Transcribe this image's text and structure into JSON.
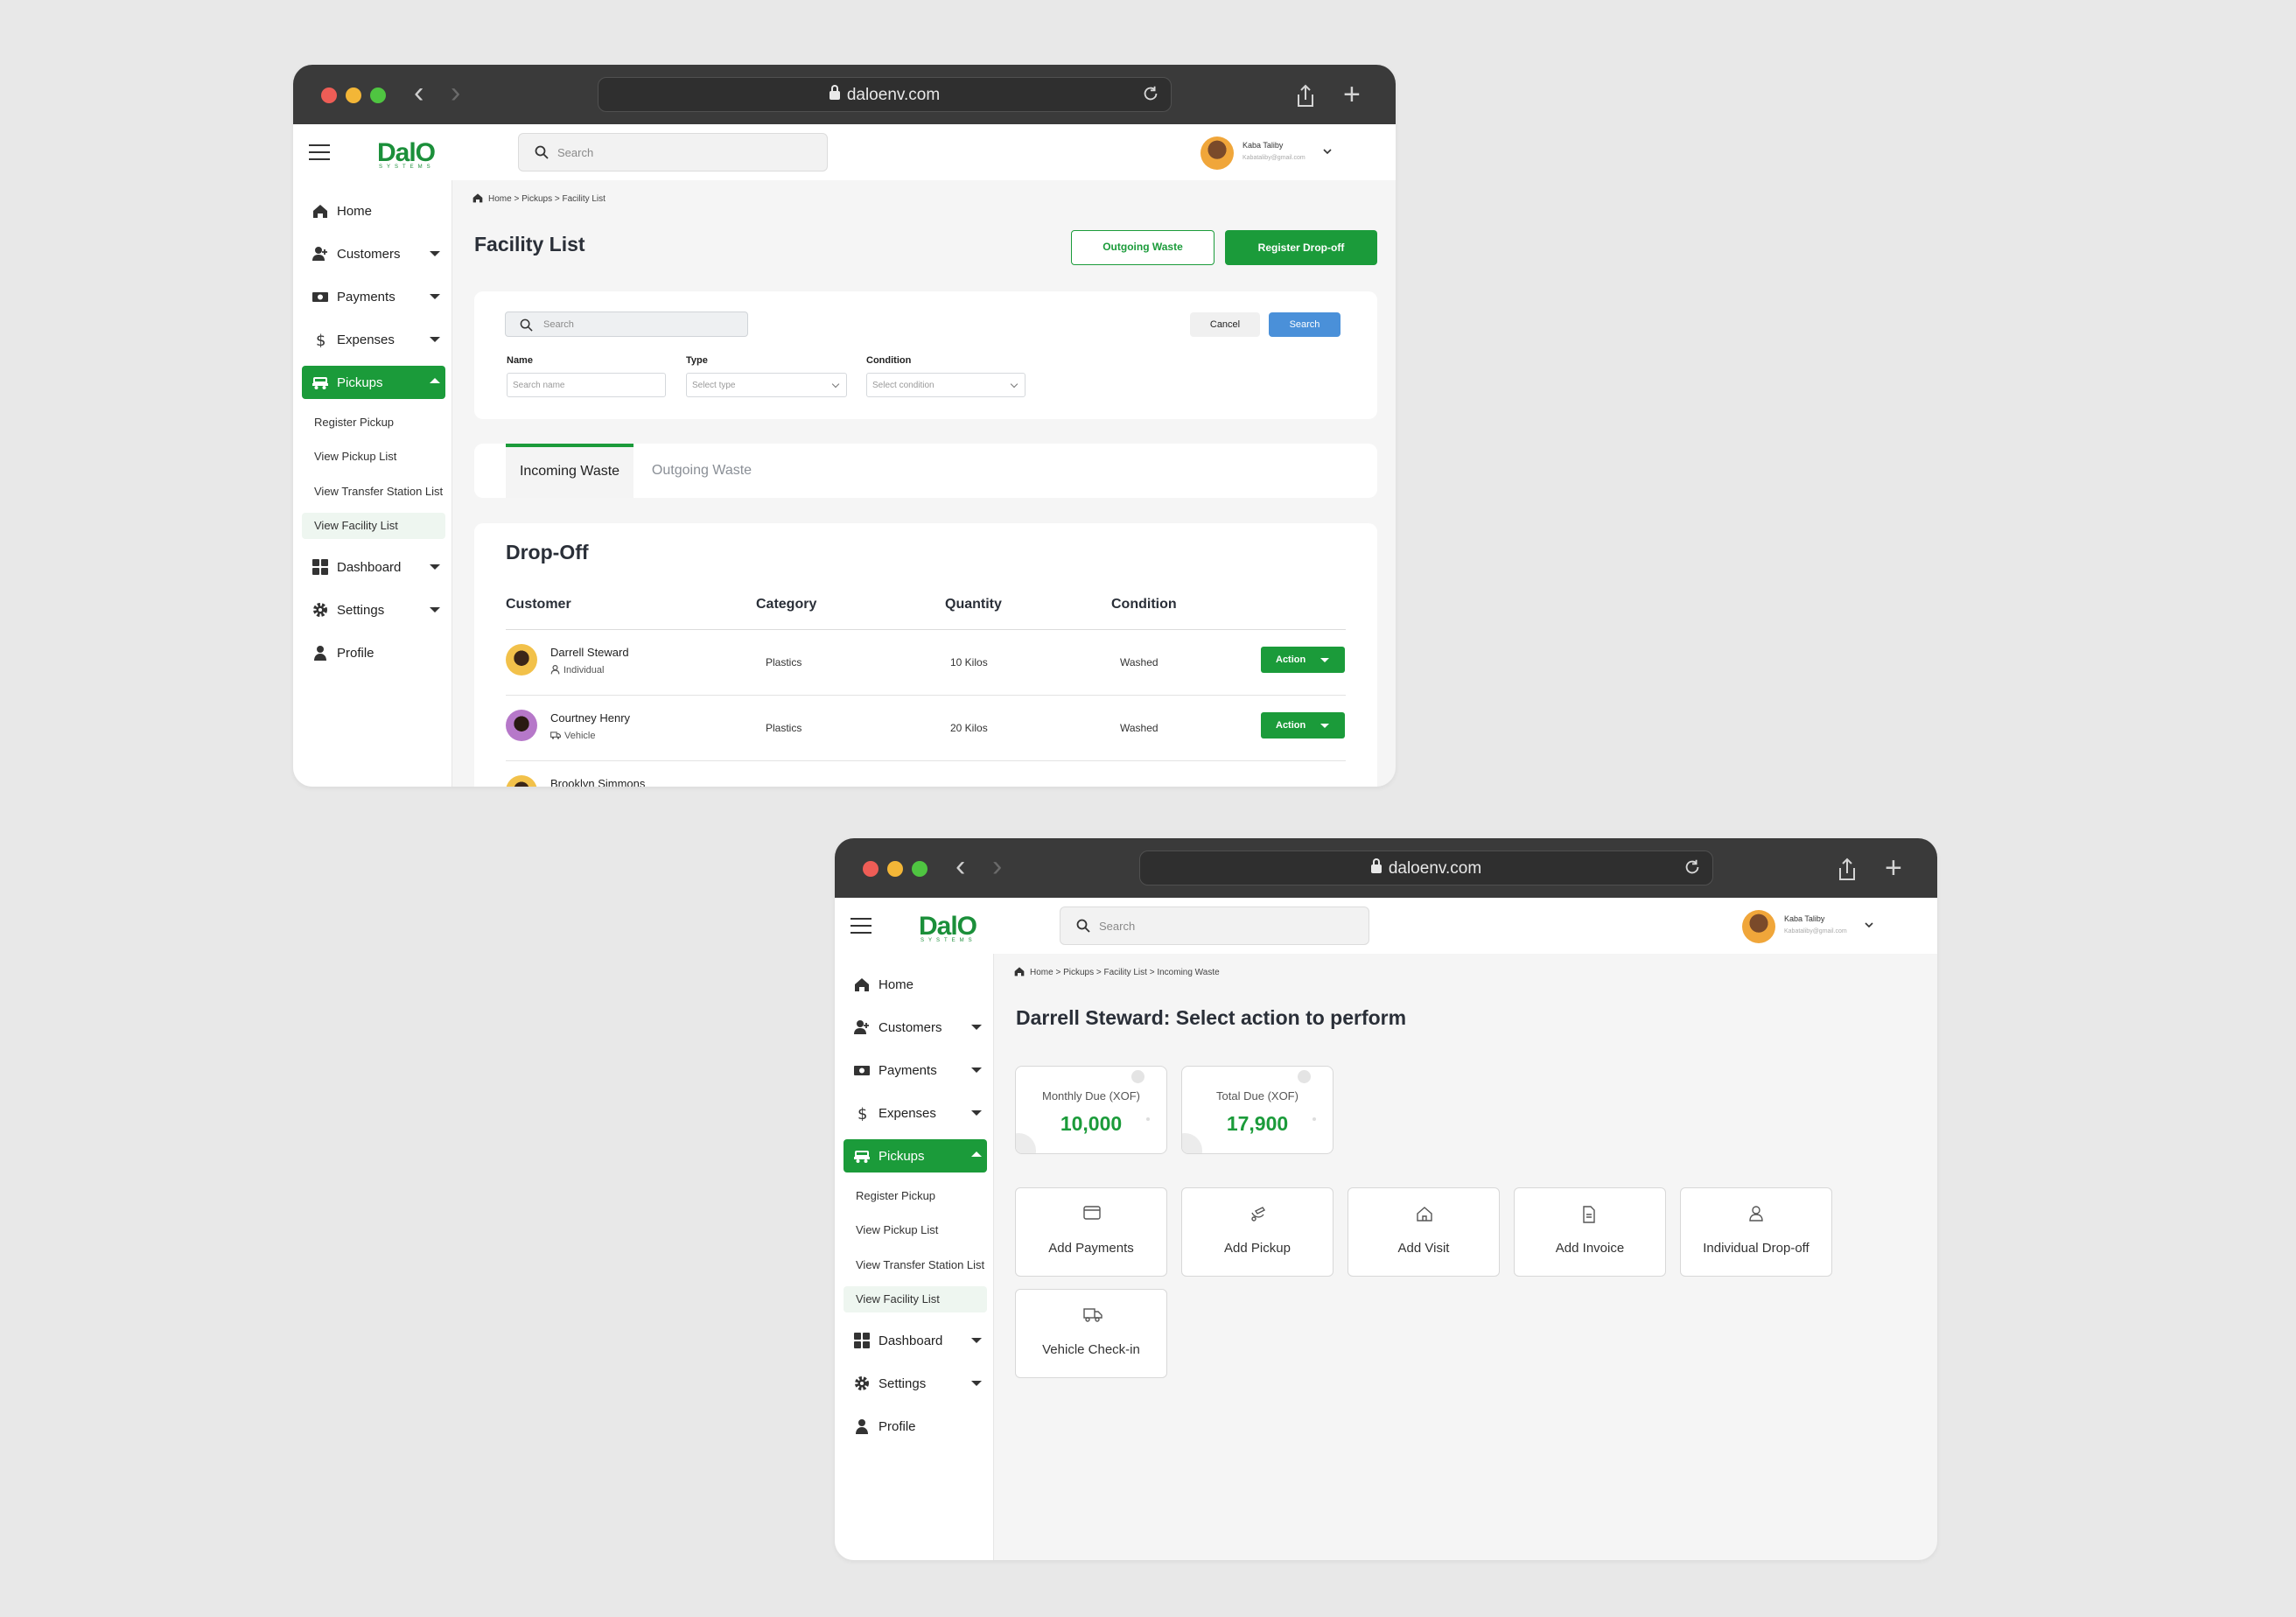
{
  "browser": {
    "url": "daloenv.com"
  },
  "header": {
    "logo": "DalO",
    "logo_sub": "SYSTEMS",
    "search_placeholder": "Search",
    "user_name": "Kaba Taliby",
    "user_email": "Kabataliby@gmail.com"
  },
  "sidebar": {
    "items": [
      {
        "label": "Home",
        "icon": "home-icon"
      },
      {
        "label": "Customers",
        "icon": "user-add-icon"
      },
      {
        "label": "Payments",
        "icon": "cash-icon"
      },
      {
        "label": "Expenses",
        "icon": "dollar-icon"
      },
      {
        "label": "Pickups",
        "icon": "truck-icon"
      },
      {
        "label": "Dashboard",
        "icon": "grid-icon"
      },
      {
        "label": "Settings",
        "icon": "gear-icon"
      },
      {
        "label": "Profile",
        "icon": "person-icon"
      }
    ],
    "subitems": [
      "Register Pickup",
      "View Pickup List",
      "View Transfer Station List",
      "View Facility List"
    ]
  },
  "facility": {
    "breadcrumb": "Home > Pickups > Facility List",
    "title": "Facility List",
    "outgoing_btn": "Outgoing Waste",
    "register_btn": "Register Drop-off",
    "filters": {
      "search_placeholder": "Search",
      "cancel": "Cancel",
      "search": "Search",
      "name_label": "Name",
      "name_placeholder": "Search name",
      "type_label": "Type",
      "type_placeholder": "Select type",
      "condition_label": "Condition",
      "condition_placeholder": "Select condition"
    },
    "tabs": [
      "Incoming Waste",
      "Outgoing Waste"
    ],
    "section_title": "Drop-Off",
    "columns": [
      "Customer",
      "Category",
      "Quantity",
      "Condition"
    ],
    "rows": [
      {
        "name": "Darrell Steward",
        "type": "Individual",
        "category": "Plastics",
        "quantity": "10 Kilos",
        "condition": "Washed",
        "action": "Action"
      },
      {
        "name": "Courtney Henry",
        "type": "Vehicle",
        "category": "Plastics",
        "quantity": "20 Kilos",
        "condition": "Washed",
        "action": "Action"
      },
      {
        "name": "Brooklyn Simmons"
      }
    ]
  },
  "action_page": {
    "breadcrumb": "Home > Pickups > Facility List > Incoming Waste",
    "title": "Darrell Steward: Select action to perform",
    "dues": [
      {
        "label": "Monthly Due (XOF)",
        "value": "10,000"
      },
      {
        "label": "Total Due (XOF)",
        "value": "17,900"
      }
    ],
    "actions": [
      {
        "label": "Add Payments",
        "icon": "card-icon"
      },
      {
        "label": "Add Pickup",
        "icon": "pickup-icon"
      },
      {
        "label": "Add Visit",
        "icon": "house-icon"
      },
      {
        "label": "Add Invoice",
        "icon": "document-icon"
      },
      {
        "label": "Individual Drop-off",
        "icon": "person-icon"
      },
      {
        "label": "Vehicle Check-in",
        "icon": "truck-icon"
      }
    ]
  },
  "colors": {
    "brand_green": "#1b9b3a",
    "search_blue": "#4a90d9",
    "chrome": "#3a3a3a"
  }
}
